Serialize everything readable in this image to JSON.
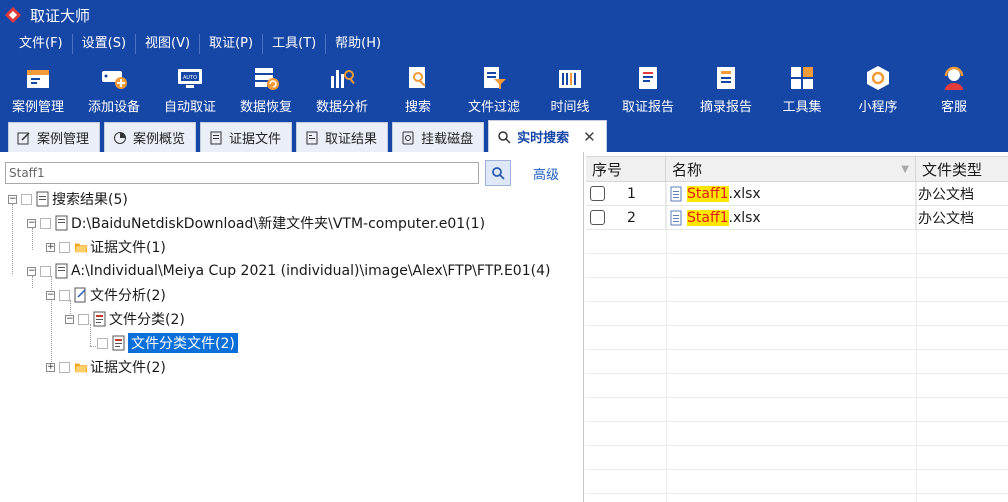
{
  "app": {
    "title": "取证大师",
    "accent": "#1747a6"
  },
  "menu": [
    "文件(F)",
    "设置(S)",
    "视图(V)",
    "取证(P)",
    "工具(T)",
    "帮助(H)"
  ],
  "toolbar": [
    {
      "label": "案例管理",
      "icon": "case-management-icon"
    },
    {
      "label": "添加设备",
      "icon": "add-device-icon"
    },
    {
      "label": "自动取证",
      "icon": "auto-forensics-icon"
    },
    {
      "label": "数据恢复",
      "icon": "data-recovery-icon"
    },
    {
      "label": "数据分析",
      "icon": "data-analysis-icon"
    },
    {
      "label": "搜索",
      "icon": "search-doc-icon"
    },
    {
      "label": "文件过滤",
      "icon": "file-filter-icon"
    },
    {
      "label": "时间线",
      "icon": "timeline-icon"
    },
    {
      "label": "取证报告",
      "icon": "forensic-report-icon"
    },
    {
      "label": "摘录报告",
      "icon": "excerpt-report-icon"
    },
    {
      "label": "工具集",
      "icon": "toolset-icon"
    },
    {
      "label": "小程序",
      "icon": "mini-program-icon"
    },
    {
      "label": "客服",
      "icon": "customer-service-icon"
    }
  ],
  "tabs": [
    {
      "label": "案例管理",
      "icon": "edit-icon"
    },
    {
      "label": "案例概览",
      "icon": "pie-icon"
    },
    {
      "label": "证据文件",
      "icon": "document-icon"
    },
    {
      "label": "取证结果",
      "icon": "result-icon"
    },
    {
      "label": "挂载磁盘",
      "icon": "disk-icon"
    },
    {
      "label": "实时搜索",
      "icon": "search-icon",
      "active": true
    }
  ],
  "search": {
    "value": "Staff1",
    "advanced": "高级"
  },
  "tree": {
    "root": "搜索结果(5)",
    "n1": "D:\\BaiduNetdiskDownload\\新建文件夹\\VTM-computer.e01(1)",
    "n1a": "证据文件(1)",
    "n2": "A:\\Individual\\Meiya Cup 2021 (individual)\\image\\Alex\\FTP\\FTP.E01(4)",
    "n2a": "文件分析(2)",
    "n2a1": "文件分类(2)",
    "n2a1a": "文件分类文件(2)",
    "n2b": "证据文件(2)"
  },
  "grid": {
    "headers": {
      "idx": "序号",
      "name": "名称",
      "type": "文件类型"
    },
    "rows": [
      {
        "idx": "1",
        "hl": "Staff1",
        "rest": ".xlsx",
        "type": "办公文档"
      },
      {
        "idx": "2",
        "hl": "Staff1",
        "rest": ".xlsx",
        "type": "办公文档"
      }
    ]
  }
}
